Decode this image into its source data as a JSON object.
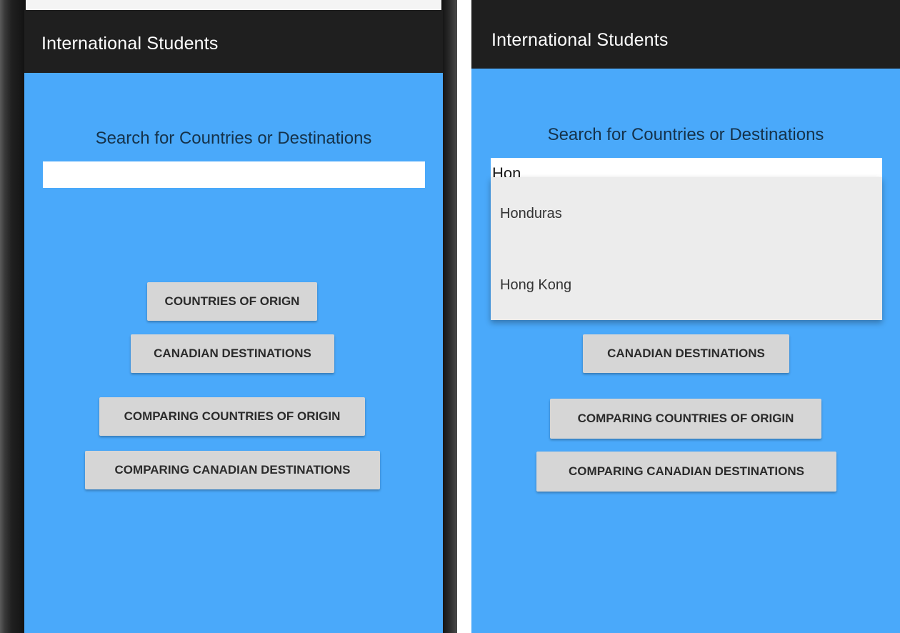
{
  "app_title": "International Students",
  "search": {
    "label": "Search for Countries or Destinations",
    "left_value": "",
    "right_value": "Hon"
  },
  "buttons": {
    "countries_of_origin": "COUNTRIES OF ORIGN",
    "canadian_destinations": "CANADIAN DESTINATIONS",
    "comparing_countries": "COMPARING COUNTRIES OF ORIGIN",
    "comparing_destinations": "COMPARING CANADIAN DESTINATIONS"
  },
  "suggestions": [
    "Honduras",
    "Hong Kong"
  ],
  "colors": {
    "content_background": "#4aa9fa",
    "title_bar": "#1f1f1f",
    "button": "#d6d6d6",
    "dropdown": "#ececec"
  }
}
